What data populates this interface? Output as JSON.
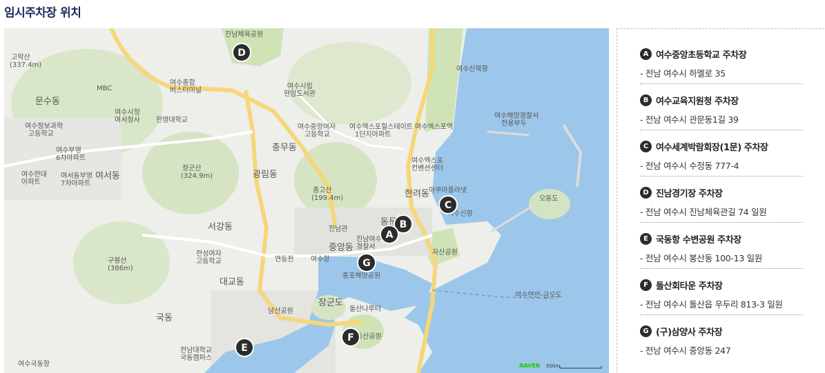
{
  "page_title": "임시주차장 위치",
  "map": {
    "attribution": "NAVER",
    "scale_label": "500m",
    "district_labels": [
      "문수동",
      "충무동",
      "광림동",
      "여서동",
      "서강동",
      "중앙동",
      "동문동",
      "한려동",
      "대교동",
      "국동",
      "장군도"
    ],
    "place_labels": [
      "고락산(337.4m)",
      "MBC",
      "여수시청 여서청사",
      "여수정보과학 고등학교",
      "여수부영 6차아파트",
      "여수한대 아파트",
      "여서동부영 7차아파트",
      "한영대학교",
      "여수종합 버스터미널",
      "여수시립 현암도서관",
      "여수중앙여자 고등학교",
      "여수엑스포힐스테이트 1단지아파트",
      "여수엑스포역",
      "여수신북항",
      "여수해양경찰서 전용부두",
      "여수엑스포 컨벤션센터",
      "아쿠아플라넷",
      "여수신항",
      "오동도",
      "장군산(324.9m)",
      "종고산(199.4m)",
      "진남관",
      "진남여수 경찰서",
      "여수중앙여자 고등학교",
      "자산공원",
      "구봉산(386m)",
      "전성여자 고등학교",
      "연등천",
      "종포해양공원",
      "남산공원",
      "돌산공원",
      "돌산나루터",
      "전남대학교 국동캠퍼스",
      "여수항",
      "진남체육공원",
      "여수엑스포",
      "여수연안-금오도"
    ],
    "markers": [
      {
        "letter": "A",
        "label": "여수중앙초등학교 주차장"
      },
      {
        "letter": "B",
        "label": "여수교육지원청 주차장"
      },
      {
        "letter": "C",
        "label": "여수세계박람회장(1문) 주차장"
      },
      {
        "letter": "D",
        "label": "진남경기장 주차장"
      },
      {
        "letter": "E",
        "label": "국동항 수변공원 주차장"
      },
      {
        "letter": "F",
        "label": "돌산회타운 주차장"
      },
      {
        "letter": "G",
        "label": "(구)삼양사 주차장"
      }
    ]
  },
  "legend": [
    {
      "letter": "A",
      "name": "여수중앙초등학교 주차장",
      "address": "- 전남 여수시 하멜로 35"
    },
    {
      "letter": "B",
      "name": "여수교육지원청 주차장",
      "address": "- 전남 여수시 관문동1길 39"
    },
    {
      "letter": "C",
      "name": "여수세계박람회장(1문) 주차장",
      "address": "- 전남 여수시 수정동 777-4"
    },
    {
      "letter": "D",
      "name": "진남경기장 주차장",
      "address": "- 전남 여수시 진남체육관길 74 일원"
    },
    {
      "letter": "E",
      "name": "국동항 수변공원 주차장",
      "address": "- 전남 여수시 봉산동 100-13 일원"
    },
    {
      "letter": "F",
      "name": "돌산회타운 주차장",
      "address": "- 전남 여수시 돌산읍 우두리 813-3 일원"
    },
    {
      "letter": "G",
      "name": "(구)삼양사 주차장",
      "address": "- 전남 여수시 중앙동 247"
    }
  ],
  "colors": {
    "water": "#9cc7ea",
    "park": "#cfe3b6",
    "road": "#f5d77a",
    "land": "#eeeeea",
    "marker": "#2c2c2c",
    "title": "#1a2a5c"
  }
}
